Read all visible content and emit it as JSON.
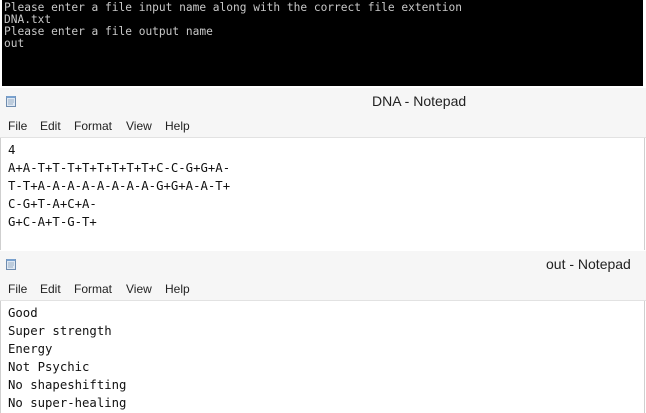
{
  "console": {
    "lines": [
      "Please enter a file input name along with the correct file extention",
      "DNA.txt",
      "Please enter a file output name",
      "out"
    ]
  },
  "notepad_dna": {
    "title": "DNA - Notepad",
    "icon": "notepad-icon",
    "menu": [
      "File",
      "Edit",
      "Format",
      "View",
      "Help"
    ],
    "content_lines": [
      "4",
      "A+A-T+T-T+T+T+T+T+T+C-C-G+G+A-",
      "T-T+A-A-A-A-A-A-A-A-G+G+A-A-T+",
      "C-G+T-A+C+A-",
      "G+C-A+T-G-T+"
    ]
  },
  "notepad_out": {
    "title": "out - Notepad",
    "icon": "notepad-icon",
    "menu": [
      "File",
      "Edit",
      "Format",
      "View",
      "Help"
    ],
    "content_lines": [
      "Good",
      "Super strength",
      "Energy",
      "Not Psychic",
      "No shapeshifting",
      "No super-healing"
    ]
  },
  "colors": {
    "console_bg": "#000000",
    "console_text": "#c8c8c8",
    "chrome_bg": "#f6f6f6",
    "editor_bg": "#ffffff"
  }
}
